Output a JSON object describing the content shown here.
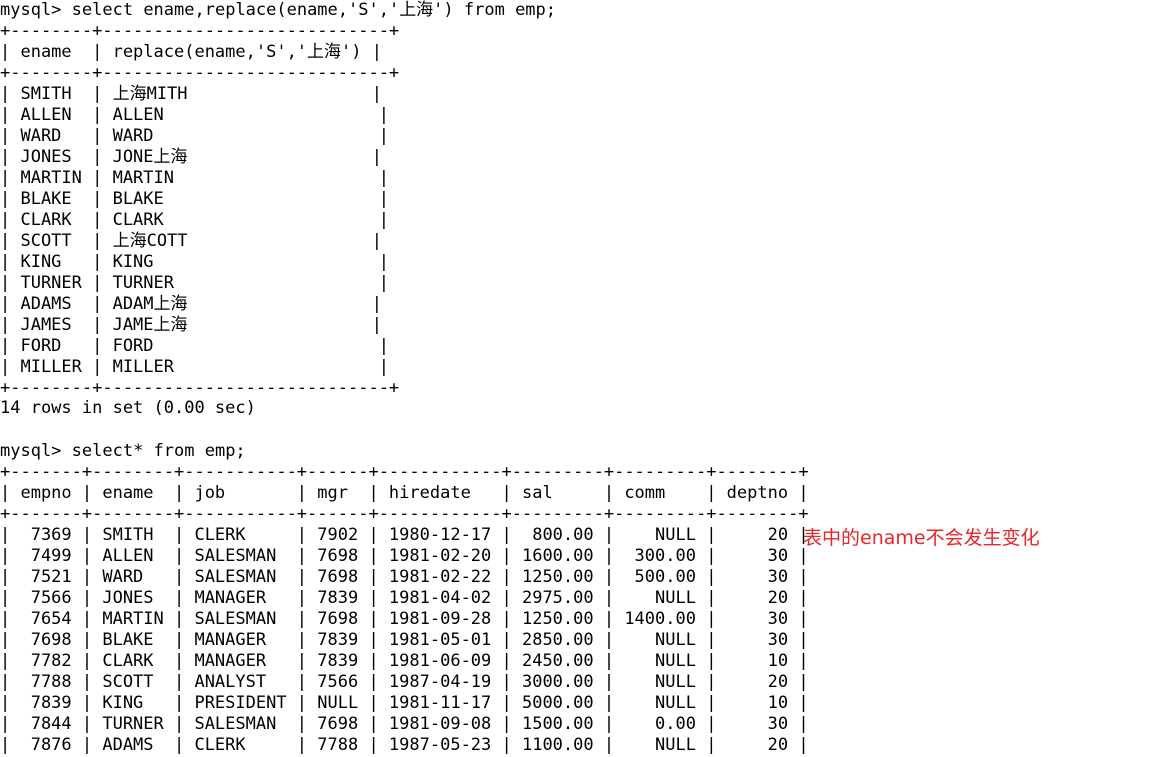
{
  "query1": {
    "prompt": "mysql>",
    "command": "select ename,replace(ename,'S','上海') from emp;",
    "border": "+--------+----------------------------+",
    "columns": [
      "ename",
      "replace(ename,'S','上海')"
    ],
    "rows": [
      [
        "SMITH",
        "上海MITH"
      ],
      [
        "ALLEN",
        "ALLEN"
      ],
      [
        "WARD",
        "WARD"
      ],
      [
        "JONES",
        "JONE上海"
      ],
      [
        "MARTIN",
        "MARTIN"
      ],
      [
        "BLAKE",
        "BLAKE"
      ],
      [
        "CLARK",
        "CLARK"
      ],
      [
        "SCOTT",
        "上海COTT"
      ],
      [
        "KING",
        "KING"
      ],
      [
        "TURNER",
        "TURNER"
      ],
      [
        "ADAMS",
        "ADAM上海"
      ],
      [
        "JAMES",
        "JAME上海"
      ],
      [
        "FORD",
        "FORD"
      ],
      [
        "MILLER",
        "MILLER"
      ]
    ],
    "result_summary": "14 rows in set (0.00 sec)"
  },
  "query2": {
    "prompt": "mysql>",
    "command": "select* from emp;",
    "border": "+-------+--------+-----------+------+------------+---------+---------+--------+",
    "columns": [
      "empno",
      "ename",
      "job",
      "mgr",
      "hiredate",
      "sal",
      "comm",
      "deptno"
    ],
    "rows": [
      [
        "7369",
        "SMITH",
        "CLERK",
        "7902",
        "1980-12-17",
        "800.00",
        "NULL",
        "20"
      ],
      [
        "7499",
        "ALLEN",
        "SALESMAN",
        "7698",
        "1981-02-20",
        "1600.00",
        "300.00",
        "30"
      ],
      [
        "7521",
        "WARD",
        "SALESMAN",
        "7698",
        "1981-02-22",
        "1250.00",
        "500.00",
        "30"
      ],
      [
        "7566",
        "JONES",
        "MANAGER",
        "7839",
        "1981-04-02",
        "2975.00",
        "NULL",
        "20"
      ],
      [
        "7654",
        "MARTIN",
        "SALESMAN",
        "7698",
        "1981-09-28",
        "1250.00",
        "1400.00",
        "30"
      ],
      [
        "7698",
        "BLAKE",
        "MANAGER",
        "7839",
        "1981-05-01",
        "2850.00",
        "NULL",
        "30"
      ],
      [
        "7782",
        "CLARK",
        "MANAGER",
        "7839",
        "1981-06-09",
        "2450.00",
        "NULL",
        "10"
      ],
      [
        "7788",
        "SCOTT",
        "ANALYST",
        "7566",
        "1987-04-19",
        "3000.00",
        "NULL",
        "20"
      ],
      [
        "7839",
        "KING",
        "PRESIDENT",
        "NULL",
        "1981-11-17",
        "5000.00",
        "NULL",
        "10"
      ],
      [
        "7844",
        "TURNER",
        "SALESMAN",
        "7698",
        "1981-09-08",
        "1500.00",
        "0.00",
        "30"
      ],
      [
        "7876",
        "ADAMS",
        "CLERK",
        "7788",
        "1987-05-23",
        "1100.00",
        "NULL",
        "20"
      ]
    ]
  },
  "annotation": {
    "text": "表中的ename不会发生变化",
    "color": "#e8262a"
  }
}
